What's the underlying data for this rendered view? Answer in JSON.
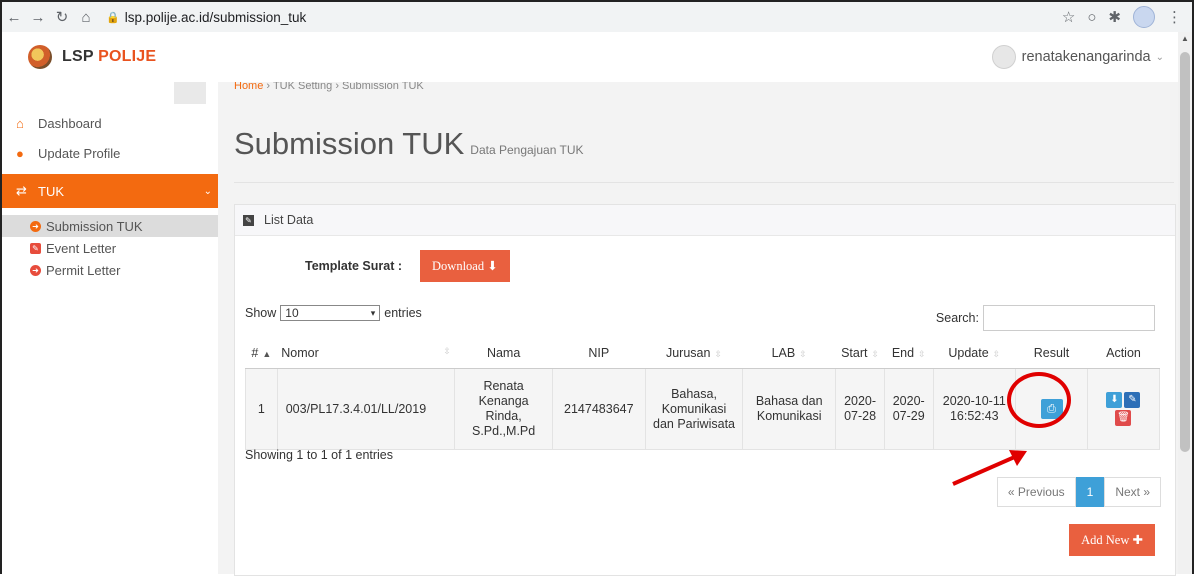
{
  "browser": {
    "url": "lsp.polije.ac.id/submission_tuk",
    "back_icon": "arrow-left-icon",
    "forward_icon": "arrow-right-icon",
    "reload_icon": "reload-icon",
    "home_icon": "home-icon"
  },
  "header": {
    "logo_text_1": "LSP",
    "logo_text_2": "POLIJE",
    "user_name": "renatakenangarinda"
  },
  "sidebar": {
    "items": [
      {
        "label": "Dashboard",
        "icon": "home-icon"
      },
      {
        "label": "Update Profile",
        "icon": "user-icon"
      },
      {
        "label": "TUK",
        "icon": "transfer-icon"
      }
    ],
    "submenu": [
      {
        "label": "Submission TUK",
        "icon": "arrow-circle-icon"
      },
      {
        "label": "Event Letter",
        "icon": "edit-icon"
      },
      {
        "label": "Permit Letter",
        "icon": "arrow-circle-icon"
      }
    ]
  },
  "breadcrumb": {
    "home": "Home",
    "item2": "TUK Setting",
    "item3": "Submission TUK"
  },
  "page": {
    "title": "Submission TUK",
    "subtitle": "Data Pengajuan TUK"
  },
  "portlet": {
    "title": "List Data",
    "template_label": "Template Surat :",
    "download_label": "Download"
  },
  "datatable": {
    "show_label": "Show",
    "entries_value": "10",
    "entries_label": "entries",
    "search_label": "Search:",
    "columns": [
      "#",
      "Nomor",
      "Nama",
      "NIP",
      "Jurusan",
      "LAB",
      "Start",
      "End",
      "Update",
      "Result",
      "Action"
    ],
    "rows": [
      {
        "no": "1",
        "nomor": "003/PL17.3.4.01/LL/2019",
        "nama_1": "Renata",
        "nama_2": "Kenanga",
        "nama_3": "Rinda,",
        "nama_4": "S.Pd.,M.Pd",
        "nip": "2147483647",
        "jurusan_1": "Bahasa,",
        "jurusan_2": "Komunikasi",
        "jurusan_3": "dan Pariwisata",
        "lab_1": "Bahasa dan",
        "lab_2": "Komunikasi",
        "start_1": "2020-",
        "start_2": "07-28",
        "end_1": "2020-",
        "end_2": "07-29",
        "update_1": "2020-10-11",
        "update_2": "16:52:43"
      }
    ],
    "info": "Showing 1 to 1 of 1 entries",
    "previous": "« Previous",
    "page": "1",
    "next": "Next »",
    "add_new": "Add New"
  },
  "colors": {
    "accent": "#f36a10",
    "button_orange": "#e9603f",
    "button_blue": "#3ea0d8",
    "annotation": "#e00000"
  }
}
